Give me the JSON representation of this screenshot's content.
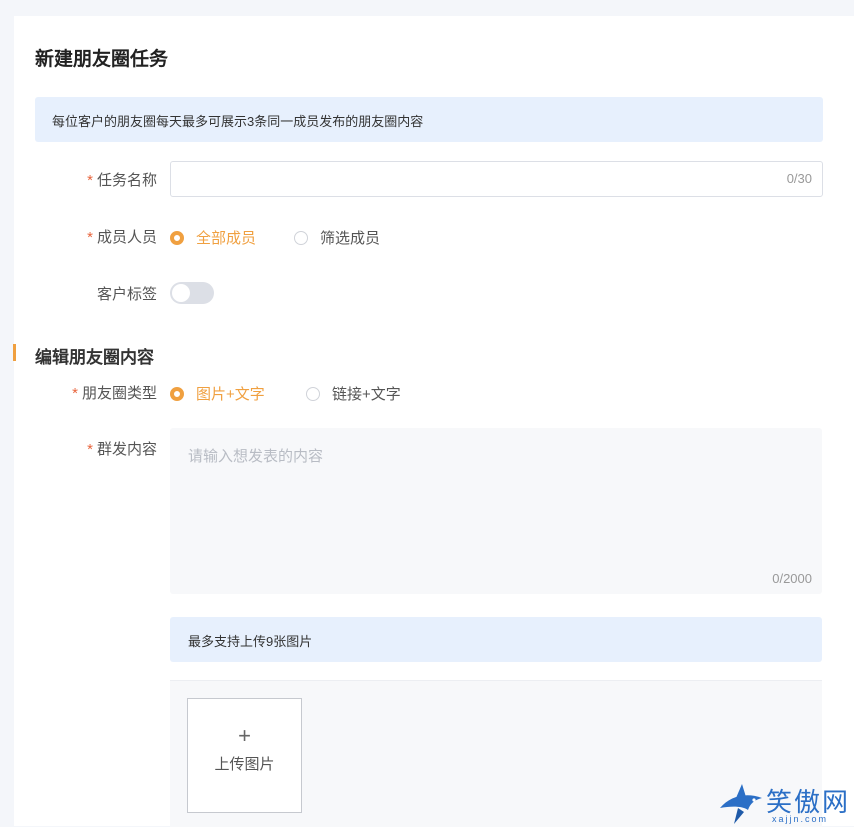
{
  "page": {
    "title": "新建朋友圈任务"
  },
  "notice": {
    "text": "每位客户的朋友圈每天最多可展示3条同一成员发布的朋友圈内容"
  },
  "form": {
    "required_mark": "*",
    "task_name": {
      "label": "任务名称",
      "value": "",
      "counter": "0/30"
    },
    "members": {
      "label": "成员人员",
      "options": [
        "全部成员",
        "筛选成员"
      ],
      "selected": "全部成员"
    },
    "customer_tag": {
      "label": "客户标签",
      "enabled": false
    }
  },
  "section": {
    "title": "编辑朋友圈内容"
  },
  "content": {
    "type": {
      "label": "朋友圈类型",
      "options": [
        "图片+文字",
        "链接+文字"
      ],
      "selected": "图片+文字"
    },
    "message": {
      "label": "群发内容",
      "placeholder": "请输入想发表的内容",
      "counter": "0/2000"
    },
    "upload_tip": "最多支持上传9张图片",
    "upload": {
      "plus": "+",
      "label": "上传图片"
    }
  },
  "watermark": {
    "text": "笑傲网",
    "url": "xajjn.com"
  },
  "colors": {
    "accent": "#f0a040",
    "required": "#e8643c",
    "notice_bg": "#e7f0fd"
  }
}
